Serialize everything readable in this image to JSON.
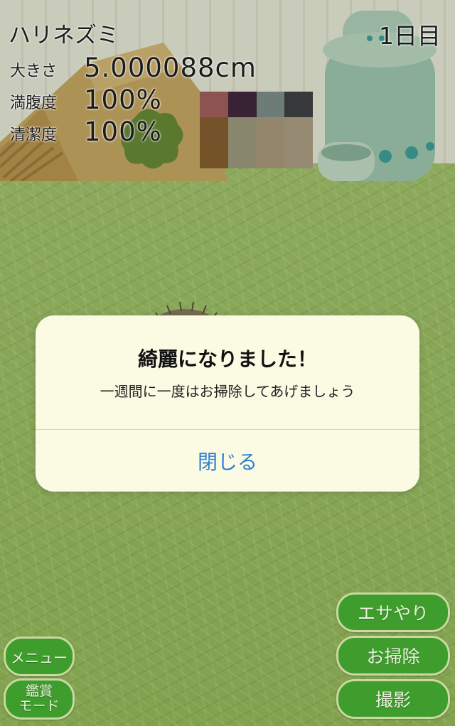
{
  "hud": {
    "animal_name": "ハリネズミ",
    "day": "1日目",
    "stats": {
      "size_label": "大きさ",
      "size_value": "5.000088cm",
      "fullness_label": "満腹度",
      "fullness_value": "100%",
      "cleanliness_label": "清潔度",
      "cleanliness_value": "100%"
    }
  },
  "buttons": {
    "feed": "エサやり",
    "clean": "お掃除",
    "photo": "撮影",
    "menu": "メニュー",
    "view_mode_line1": "鑑賞",
    "view_mode_line2": "モード"
  },
  "dialog": {
    "title": "綺麗になりました！",
    "message": "一週間に一度はお掃除してあげましょう",
    "close_label": "閉じる"
  },
  "colors": {
    "button_green": "#3e9d2c",
    "dialog_bg": "#fbfbe4",
    "dialog_link": "#2f7fd2"
  }
}
